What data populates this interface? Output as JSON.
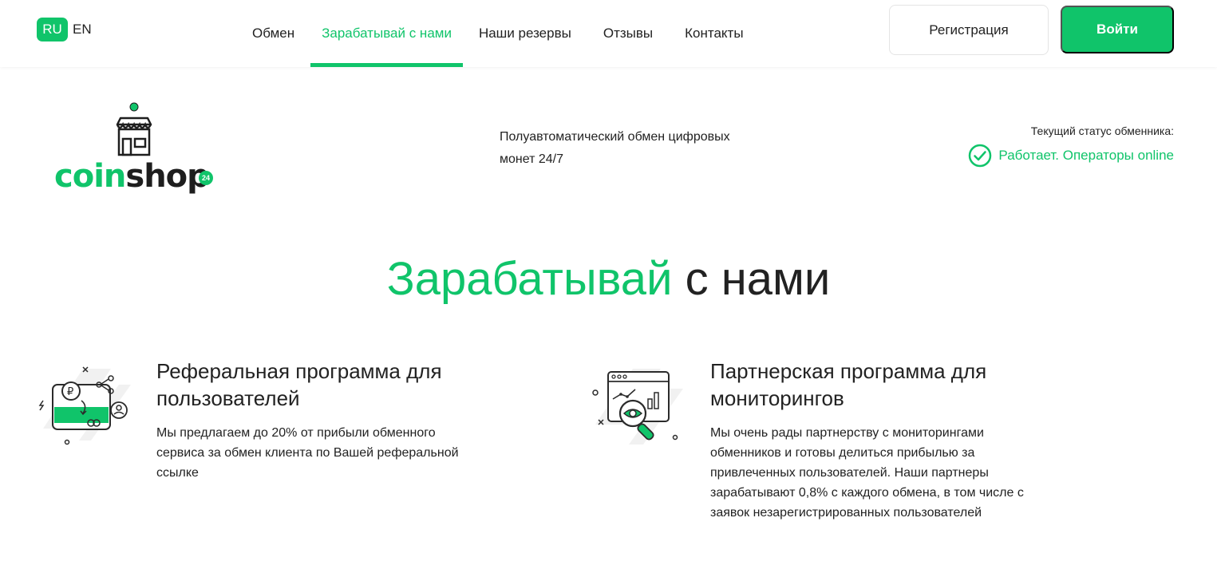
{
  "header": {
    "lang_active": "RU",
    "lang_other": "EN",
    "nav": [
      {
        "label": "Обмен"
      },
      {
        "label": "Зарабатывай с нами"
      },
      {
        "label": "Наши резервы"
      },
      {
        "label": "Отзывы"
      },
      {
        "label": "Контакты"
      }
    ],
    "register_label": "Регистрация",
    "login_label": "Войти"
  },
  "brand": {
    "logo_green": "coin",
    "logo_dark": "shop",
    "logo_badge": "24",
    "tagline": "Полуавтоматический обмен цифровых монет 24/7"
  },
  "status": {
    "label": "Текущий статус обменника:",
    "value": "Работает. Операторы online"
  },
  "title": {
    "green": "Зарабатывай",
    "dark": "с нами"
  },
  "programs": [
    {
      "icon": "referral-card-icon",
      "title": "Реферальная программа для пользователей",
      "text": "Мы предлагаем до 20% от прибыли обменного сервиса за обмен клиента по Вашей реферальной ссылке"
    },
    {
      "icon": "monitoring-analytics-icon",
      "title": "Партнерская программа для мониторингов",
      "text": "Мы очень рады партнерству с мониторингами обменников и готовы делиться прибылью за привлеченных пользователей. Наши партнеры зарабатывают 0,8% с каждого обмена, в том числе с заявок незарегистрированных пользователей"
    }
  ],
  "colors": {
    "accent": "#10c46a",
    "text": "#222222"
  }
}
